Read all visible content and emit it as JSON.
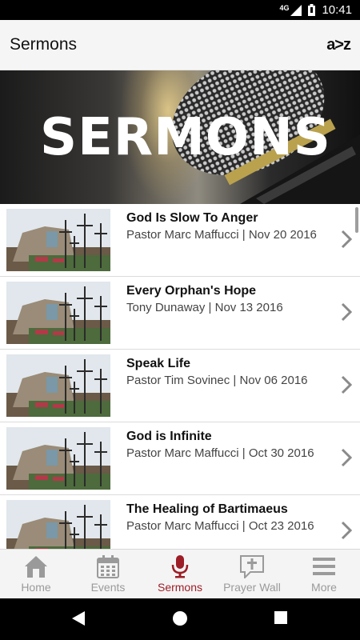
{
  "status_bar": {
    "network": "4G",
    "time": "10:41"
  },
  "app_bar": {
    "title": "Sermons",
    "sort_label": "a>z"
  },
  "banner": {
    "text": "SERMONS"
  },
  "sermons": [
    {
      "title": "God Is Slow To Anger",
      "subtitle": "Pastor Marc Maffucci | Nov 20 2016"
    },
    {
      "title": "Every Orphan's Hope",
      "subtitle": "Tony Dunaway | Nov 13 2016"
    },
    {
      "title": "Speak Life",
      "subtitle": "Pastor Tim Sovinec | Nov 06 2016"
    },
    {
      "title": "God is Infinite",
      "subtitle": "Pastor Marc Maffucci | Oct 30 2016"
    },
    {
      "title": "The Healing of Bartimaeus",
      "subtitle": "Pastor Marc Maffucci | Oct 23 2016"
    }
  ],
  "bottom_nav": [
    {
      "label": "Home",
      "icon": "home-icon",
      "active": false
    },
    {
      "label": "Events",
      "icon": "calendar-icon",
      "active": false
    },
    {
      "label": "Sermons",
      "icon": "microphone-icon",
      "active": true
    },
    {
      "label": "Prayer Wall",
      "icon": "prayer-icon",
      "active": false
    },
    {
      "label": "More",
      "icon": "menu-icon",
      "active": false
    }
  ],
  "colors": {
    "accent": "#9d1d26",
    "inactive": "#9a9a9a"
  }
}
